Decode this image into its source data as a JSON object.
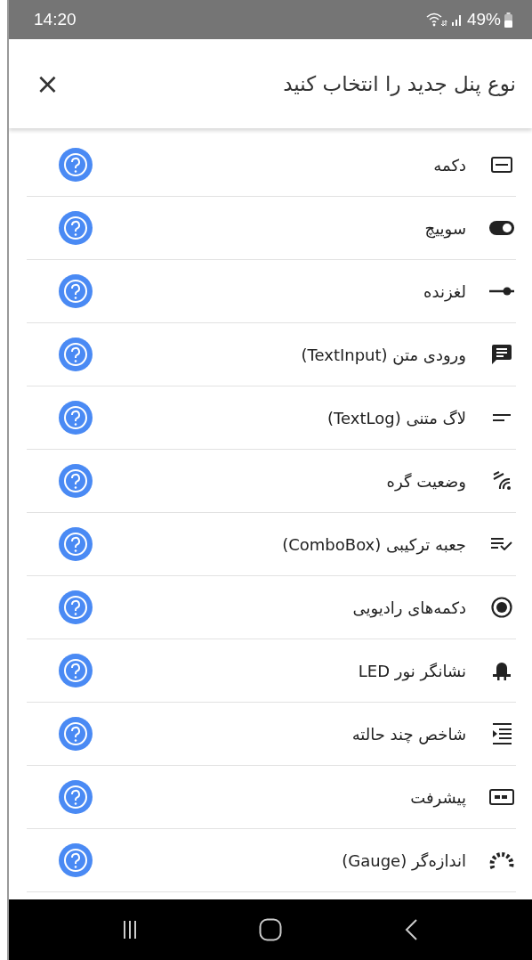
{
  "status_bar": {
    "time": "14:20",
    "battery": "49%"
  },
  "header": {
    "title": "نوع پنل جدید را انتخاب کنید",
    "close": "×"
  },
  "items": [
    {
      "kind": "button",
      "label": "دکمه"
    },
    {
      "kind": "switch",
      "label": "سوییچ"
    },
    {
      "kind": "slider",
      "label": "لغزنده"
    },
    {
      "kind": "textinput",
      "label": "ورودی متن (TextInput)"
    },
    {
      "kind": "textlog",
      "label": "لاگ متنی (TextLog)"
    },
    {
      "kind": "nodestatus",
      "label": "وضعیت گره"
    },
    {
      "kind": "combobox",
      "label": "جعبه ترکیبی (ComboBox)"
    },
    {
      "kind": "radio",
      "label": "دکمه‌های رادیویی"
    },
    {
      "kind": "led",
      "label": "نشانگر نور LED"
    },
    {
      "kind": "multistate",
      "label": "شاخص چند حالته"
    },
    {
      "kind": "progress",
      "label": "پیشرفت"
    },
    {
      "kind": "gauge",
      "label": "اندازه‌گر (Gauge)"
    }
  ]
}
